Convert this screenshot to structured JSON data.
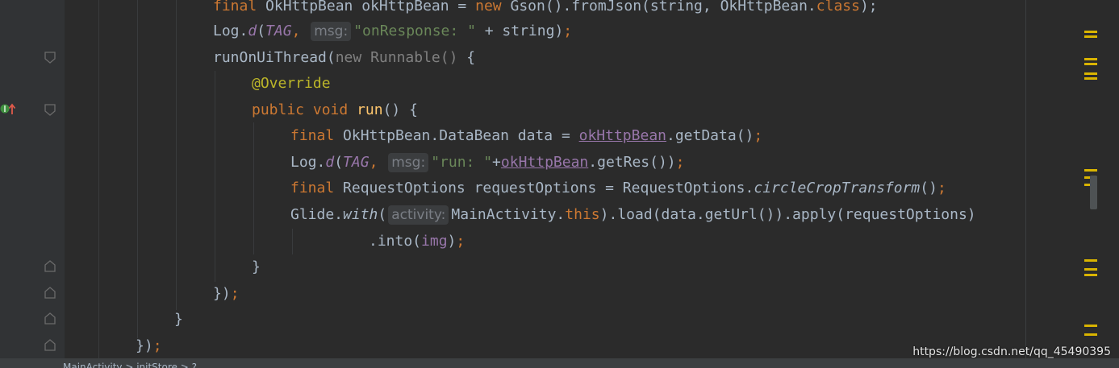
{
  "code": {
    "l1": {
      "final_kw": "final",
      "decl": " OkHttpBean okHttpBean = ",
      "new_kw": "new",
      "call": " Gson().fromJson(string, OkHttpBean.",
      "class_kw": "class",
      "end": ");"
    },
    "l2": {
      "log": "Log.",
      "d": "d",
      "open": "(",
      "tag": "TAG",
      "comma": ", ",
      "hint": "msg:",
      "str": "\"onResponse: \"",
      "rest": " + string)",
      "semi": ";"
    },
    "l3": {
      "method": "runOnUiThread(",
      "new_kw": "new",
      "runnable": " Runnable()",
      "brace": " {"
    },
    "l4": {
      "annotation": "@Override"
    },
    "l5": {
      "public_kw": "public",
      "void_kw": " void ",
      "run": "run",
      "rest": "() {"
    },
    "l6": {
      "final_kw": "final",
      "decl": " OkHttpBean.DataBean data = ",
      "var": "okHttpBean",
      "call": ".getData()",
      "semi": ";"
    },
    "l7": {
      "log": "Log.",
      "d": "d",
      "open": "(",
      "tag": "TAG",
      "comma": ", ",
      "hint": "msg:",
      "str": "\"run: \"",
      "plus": "+",
      "var": "okHttpBean",
      "call": ".getRes())",
      "semi": ";"
    },
    "l8": {
      "final_kw": "final",
      "decl": " RequestOptions requestOptions = RequestOptions.",
      "static_call": "circleCropTransform",
      "rest": "()",
      "semi": ";"
    },
    "l9": {
      "glide": "Glide.",
      "with": "with",
      "open": "(",
      "hint": "activity:",
      "cls": "MainActivity.",
      "this_kw": "this",
      "rest": ").load(data.getUrl()).apply(requestOptions)"
    },
    "l10": {
      "into": ".into(",
      "img": "img",
      "close": ")",
      "semi": ";"
    },
    "l11": {
      "brace": "}"
    },
    "l12": {
      "brace": "})",
      "semi": ";"
    },
    "l13": {
      "brace": "}"
    },
    "l14": {
      "brace": "})",
      "semi": ";"
    }
  },
  "breadcrumb": "MainActivity > initStore > ?",
  "watermark": "https://blog.csdn.net/qq_45490395",
  "icons": {
    "fold": "fold-marker-icon",
    "override": "override-method-icon",
    "marker": "warning-stripe-icon"
  },
  "colors": {
    "background": "#2b2b2b",
    "gutter": "#313335",
    "keyword": "#cc7832",
    "string": "#6a8759",
    "method": "#ffc66d",
    "field": "#9876aa",
    "annotation": "#bbb529",
    "text": "#a9b7c6",
    "marker": "#d9b400"
  }
}
